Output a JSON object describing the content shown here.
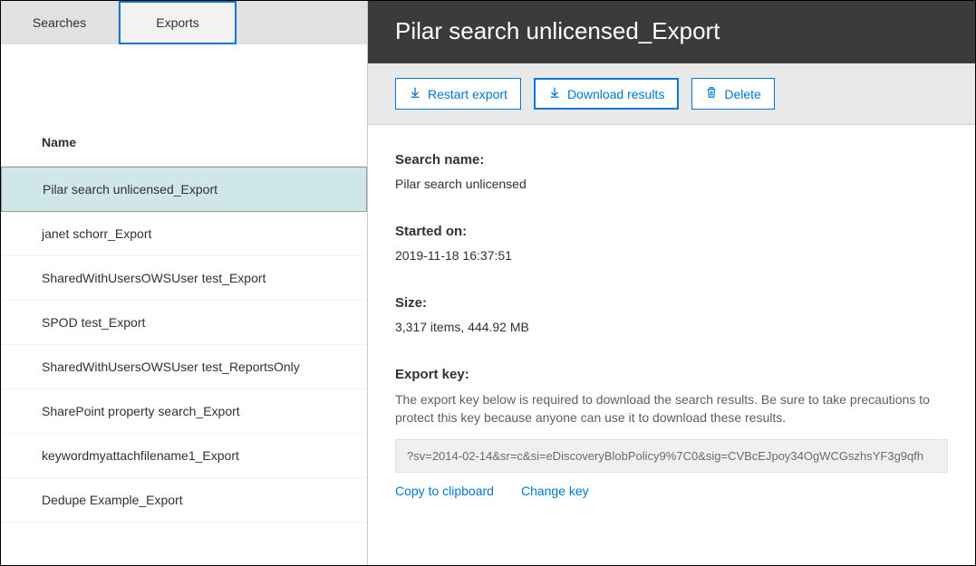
{
  "tabs": {
    "searches": "Searches",
    "exports": "Exports"
  },
  "list": {
    "header": "Name",
    "items": [
      "Pilar search unlicensed_Export",
      "janet schorr_Export",
      "SharedWithUsersOWSUser test_Export",
      "SPOD test_Export",
      "SharedWithUsersOWSUser test_ReportsOnly",
      "SharePoint property search_Export",
      "keywordmyattachfilename1_Export",
      "Dedupe Example_Export"
    ]
  },
  "detail": {
    "title": "Pilar search unlicensed_Export",
    "toolbar": {
      "restart": "Restart export",
      "download": "Download results",
      "delete": "Delete"
    },
    "search_name_label": "Search name:",
    "search_name": "Pilar search unlicensed",
    "started_label": "Started on:",
    "started": "2019-11-18 16:37:51",
    "size_label": "Size:",
    "size": "3,317 items, 444.92 MB",
    "export_key_label": "Export key:",
    "export_key_help": "The export key below is required to download the search results. Be sure to take precautions to protect this key because anyone can use it to download these results.",
    "export_key": "?sv=2014-02-14&sr=c&si=eDiscoveryBlobPolicy9%7C0&sig=CVBcEJpoy34OgWCGszhsYF3g9qfh",
    "copy_link": "Copy to clipboard",
    "change_link": "Change key"
  }
}
